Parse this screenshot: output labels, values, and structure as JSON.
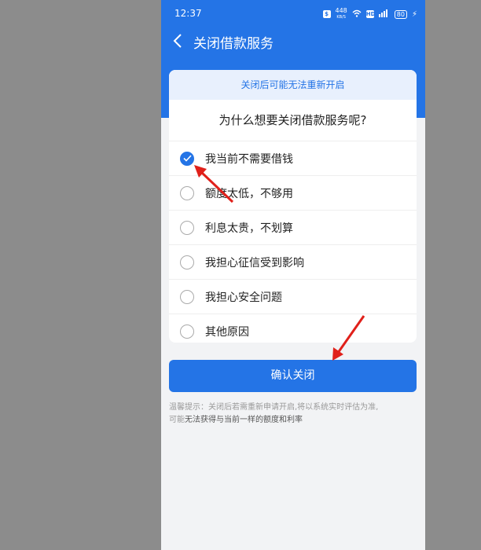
{
  "status_bar": {
    "time": "12:37",
    "speed": "448",
    "speed_unit": "KB/S",
    "hd": "HD",
    "signal": "4G",
    "battery": "80"
  },
  "header": {
    "title": "关闭借款服务"
  },
  "notice": "关闭后可能无法重新开启",
  "question": "为什么想要关闭借款服务呢?",
  "options": [
    {
      "label": "我当前不需要借钱",
      "checked": true
    },
    {
      "label": "额度太低，不够用",
      "checked": false
    },
    {
      "label": "利息太贵，不划算",
      "checked": false
    },
    {
      "label": "我担心征信受到影响",
      "checked": false
    },
    {
      "label": "我担心安全问题",
      "checked": false
    },
    {
      "label": "其他原因",
      "checked": false
    }
  ],
  "confirm_label": "确认关闭",
  "tip": {
    "line1": "温馨提示：关闭后若需重新申请开启,将以系统实时评估为准,",
    "line2_prefix": "可能",
    "line2_strong": "无法获得与当前一样的额度和利率"
  },
  "colors": {
    "brand": "#2474e6",
    "annotation": "#e0201a"
  },
  "icons": [
    "back-arrow-icon",
    "check-icon",
    "wifi-icon",
    "signal-icon",
    "battery-icon",
    "charging-icon",
    "shield-icon"
  ]
}
